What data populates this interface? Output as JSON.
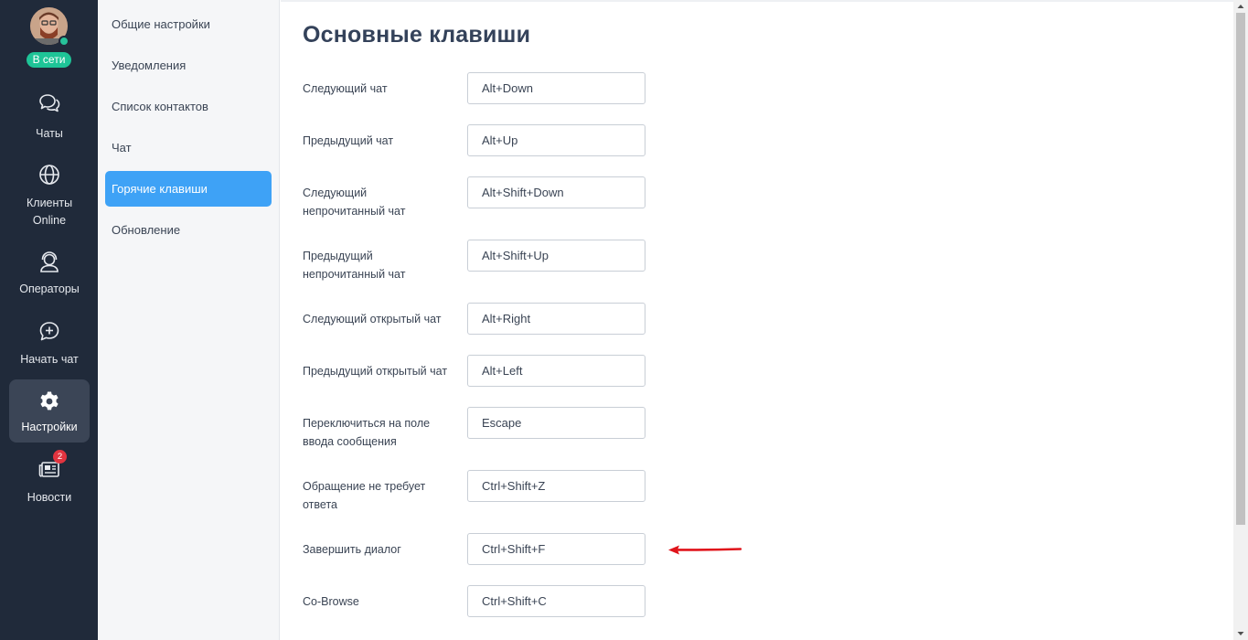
{
  "nav": {
    "status": "В сети",
    "items": [
      {
        "label": "Чаты",
        "icon": "chat-bubbles-icon"
      },
      {
        "label": "Клиенты Online",
        "icon": "globe-icon"
      },
      {
        "label": "Операторы",
        "icon": "operator-headset-icon"
      },
      {
        "label": "Начать чат",
        "icon": "chat-plus-icon"
      },
      {
        "label": "Настройки",
        "icon": "gear-icon",
        "active": true
      },
      {
        "label": "Новости",
        "icon": "newspaper-icon",
        "badge": "2"
      }
    ]
  },
  "settings_menu": {
    "items": [
      {
        "label": "Общие настройки"
      },
      {
        "label": "Уведомления"
      },
      {
        "label": "Список контактов"
      },
      {
        "label": "Чат"
      },
      {
        "label": "Горячие клавиши",
        "active": true
      },
      {
        "label": "Обновление"
      }
    ]
  },
  "main": {
    "title": "Основные клавиши",
    "rows": [
      {
        "label": "Следующий чат",
        "value": "Alt+Down"
      },
      {
        "label": "Предыдущий чат",
        "value": "Alt+Up"
      },
      {
        "label": "Следующий непрочитанный чат",
        "value": "Alt+Shift+Down"
      },
      {
        "label": "Предыдущий непрочитанный чат",
        "value": "Alt+Shift+Up"
      },
      {
        "label": "Следующий открытый чат",
        "value": "Alt+Right"
      },
      {
        "label": "Предыдущий открытый чат",
        "value": "Alt+Left"
      },
      {
        "label": "Переключиться на поле ввода сообщения",
        "value": "Escape"
      },
      {
        "label": "Обращение не требует ответа",
        "value": "Ctrl+Shift+Z"
      },
      {
        "label": "Завершить диалог",
        "value": "Ctrl+Shift+F"
      },
      {
        "label": "Co-Browse",
        "value": "Ctrl+Shift+C"
      }
    ]
  },
  "colors": {
    "sidebar": "#202a3a",
    "accent": "#3ea2f6",
    "online": "#1ec497",
    "badge": "#e2343f",
    "arrow": "#e0141b"
  }
}
